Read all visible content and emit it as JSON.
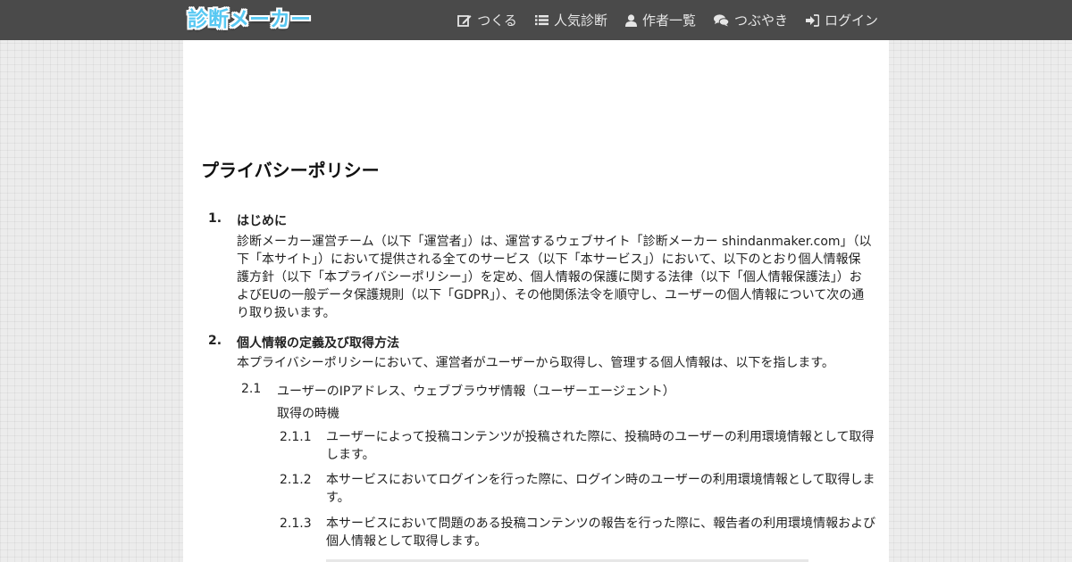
{
  "header": {
    "logo_text": "診断メーカー",
    "nav": [
      {
        "label": "つくる",
        "icon": "edit-icon"
      },
      {
        "label": "人気診断",
        "icon": "list-icon"
      },
      {
        "label": "作者一覧",
        "icon": "user-icon"
      },
      {
        "label": "つぶやき",
        "icon": "comments-icon"
      },
      {
        "label": "ログイン",
        "icon": "sign-in-icon"
      }
    ]
  },
  "page": {
    "title": "プライバシーポリシー",
    "sections": [
      {
        "number": "1.",
        "heading": "はじめに",
        "lines": [
          "診断メーカー運営チーム（以下「運営者」）は、運営するウェブサイト「診断メーカー shindanmaker.com」（以",
          "下「本サイト」）において提供される全てのサービス（以下「本サービス」）において、以下のとおり個人情報保",
          "護方針（以下「本プライバシーポリシー」）を定め、個人情報の保護に関する法律（以下「個人情報保護法」）お",
          "よびEUの一般データ保護規則（以下「GDPR」）、その他関係法令を順守し、ユーザーの個人情報について次の通",
          "り取り扱います。"
        ]
      },
      {
        "number": "2.",
        "heading": "個人情報の定義及び取得方法",
        "intro": "本プライバシーポリシーにおいて、運営者がユーザーから取得し、管理する個人情報は、以下を指します。",
        "sub": {
          "number": "2.1",
          "text": "ユーザーのIPアドレス、ウェブブラウザ情報（ユーザーエージェント）",
          "timing_label": "取得の時機",
          "items": [
            {
              "number": "2.1.1",
              "lines": [
                "ユーザーによって投稿コンテンツが投稿された際に、投稿時のユーザーの利用環境情報として取得",
                "します。"
              ]
            },
            {
              "number": "2.1.2",
              "lines": [
                "本サービスにおいてログインを行った際に、ログイン時のユーザーの利用環境情報として取得しま",
                "す。"
              ]
            },
            {
              "number": "2.1.3",
              "lines": [
                "本サービスにおいて問題のある投稿コンテンツの報告を行った際に、報告者の利用環境情報および",
                "個人情報として取得します。"
              ]
            }
          ]
        }
      }
    ]
  }
}
